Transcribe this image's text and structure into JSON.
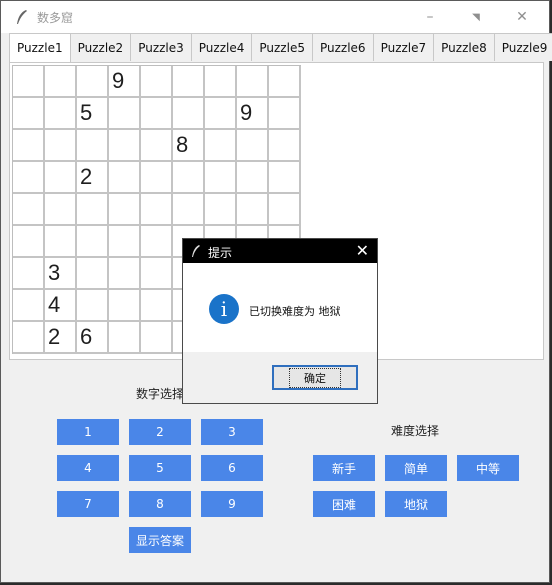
{
  "window": {
    "title": "数多窟",
    "minimize": "–",
    "maximize": "◥",
    "close": "✕"
  },
  "tabs": [
    "Puzzle1",
    "Puzzle2",
    "Puzzle3",
    "Puzzle4",
    "Puzzle5",
    "Puzzle6",
    "Puzzle7",
    "Puzzle8",
    "Puzzle9"
  ],
  "grid": [
    [
      "",
      "",
      "",
      "9",
      "",
      "",
      "",
      "",
      ""
    ],
    [
      "",
      "",
      "5",
      "",
      "",
      "",
      "",
      "9",
      ""
    ],
    [
      "",
      "",
      "",
      "",
      "",
      "8",
      "",
      "",
      ""
    ],
    [
      "",
      "",
      "2",
      "",
      "",
      "",
      "",
      "",
      ""
    ],
    [
      "",
      "",
      "",
      "",
      "",
      "",
      "",
      "",
      ""
    ],
    [
      "",
      "",
      "",
      "",
      "",
      "",
      "",
      "",
      ""
    ],
    [
      "",
      "3",
      "",
      "",
      "",
      "",
      "",
      "",
      ""
    ],
    [
      "",
      "4",
      "",
      "",
      "",
      "",
      "",
      "",
      ""
    ],
    [
      "",
      "2",
      "6",
      "",
      "",
      "",
      "",
      "",
      ""
    ]
  ],
  "number_section": {
    "label": "数字选择",
    "buttons": [
      "1",
      "2",
      "3",
      "4",
      "5",
      "6",
      "7",
      "8",
      "9"
    ],
    "answer_button": "显示答案"
  },
  "difficulty_section": {
    "label": "难度选择",
    "buttons": [
      "新手",
      "简单",
      "中等",
      "困难",
      "地狱"
    ]
  },
  "dialog": {
    "title": "提示",
    "close": "✕",
    "icon": "i",
    "message": "已切换难度为 地狱",
    "ok": "确定"
  },
  "colors": {
    "accent": "#4a86e8",
    "info": "#1a73c9"
  }
}
